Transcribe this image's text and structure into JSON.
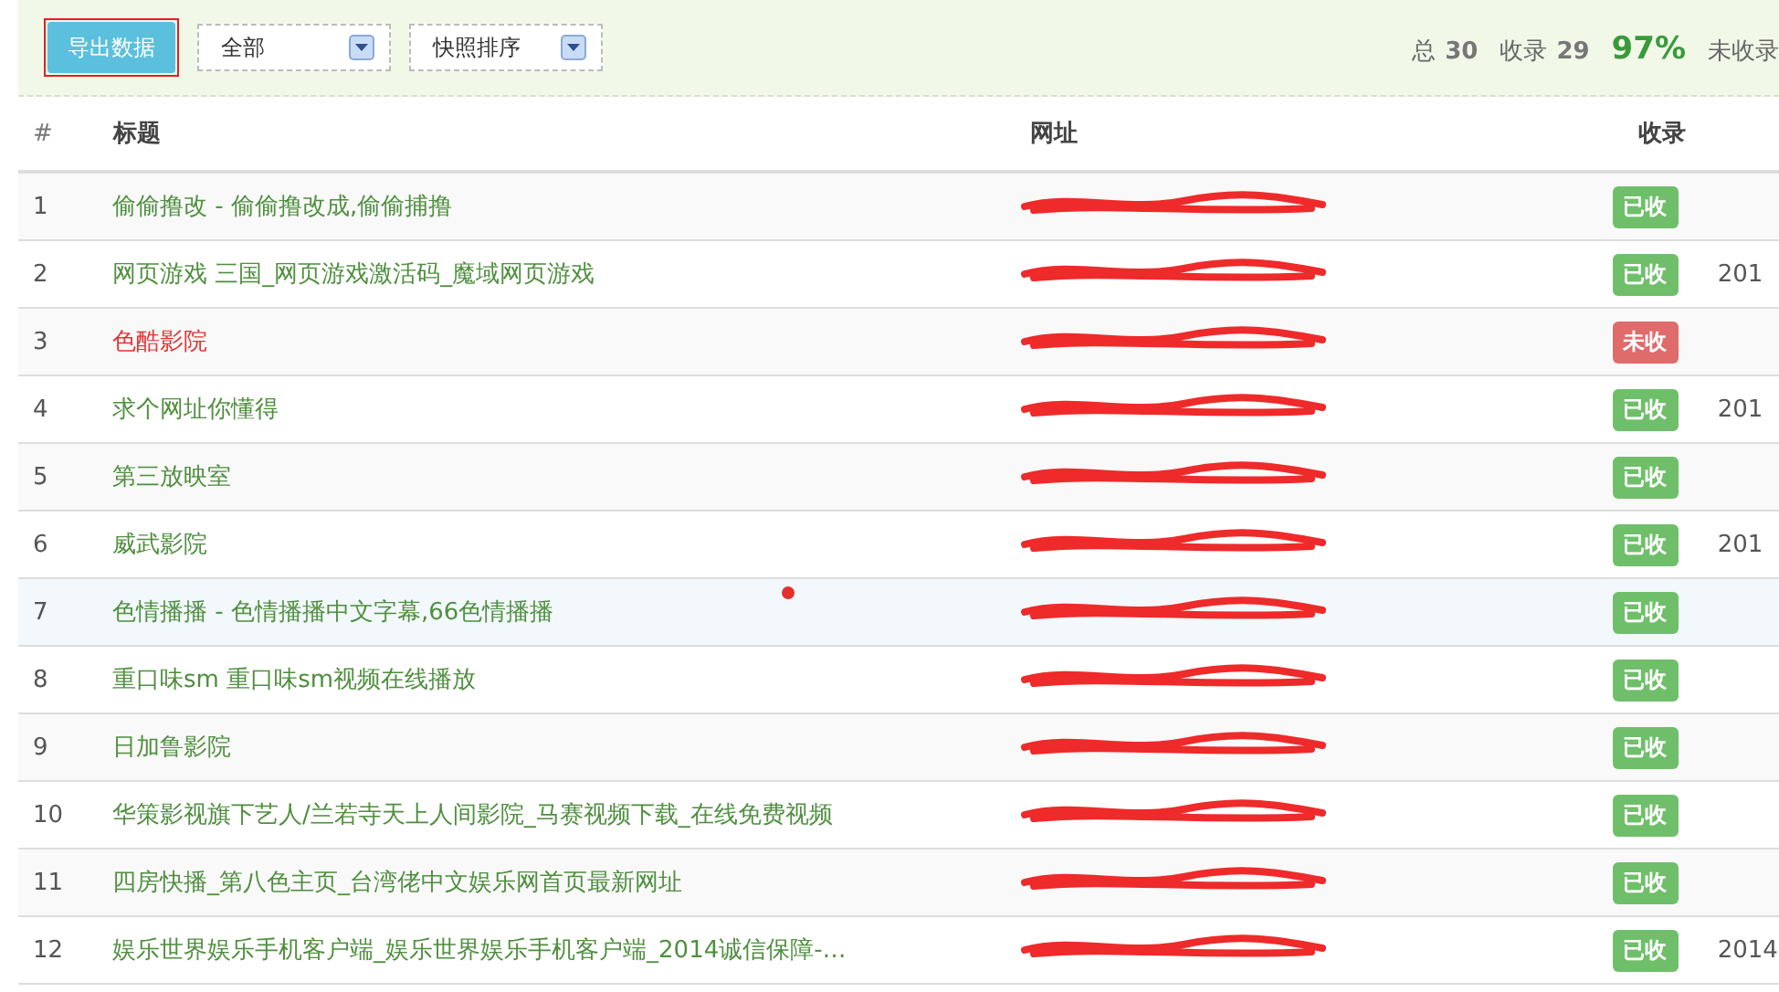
{
  "toolbar": {
    "export_button": {
      "label": "导出数据",
      "outlined": true
    },
    "dropdowns": [
      {
        "value": "全部"
      },
      {
        "value": "快照排序"
      }
    ],
    "stats": [
      {
        "label": "总",
        "value": "30"
      },
      {
        "label": "收录",
        "value": "29"
      },
      {
        "value": "97%",
        "kind": "percent"
      },
      {
        "label": "未收录"
      }
    ]
  },
  "table": {
    "columns": [
      "#",
      "标题",
      "网址",
      "收录"
    ],
    "rows": [
      {
        "index": "1",
        "title": "偷偷撸改 - 偷偷撸改成,偷偷捕撸",
        "url_redacted": true,
        "status": "已收",
        "kind": "indexed",
        "highlighted": false,
        "marked": false
      },
      {
        "index": "2",
        "title": "网页游戏 三国_网页游戏激活码_魔域网页游戏",
        "url_redacted": true,
        "status": "已收",
        "kind": "indexed",
        "date": "201",
        "highlighted": false,
        "marked": false
      },
      {
        "index": "3",
        "title": "色酷影院",
        "url_redacted": true,
        "status": "未收",
        "kind": "missing",
        "highlighted": false,
        "marked": false
      },
      {
        "index": "4",
        "title": "求个网址你懂得",
        "url_redacted": true,
        "status": "已收",
        "kind": "indexed",
        "date": "201",
        "highlighted": false,
        "marked": false
      },
      {
        "index": "5",
        "title": "第三放映室",
        "url_redacted": true,
        "status": "已收",
        "kind": "indexed",
        "highlighted": false,
        "marked": false
      },
      {
        "index": "6",
        "title": "威武影院",
        "url_redacted": true,
        "status": "已收",
        "kind": "indexed",
        "date": "201",
        "highlighted": false,
        "marked": false
      },
      {
        "index": "7",
        "title": "色情播播 - 色情播播中文字幕,66色情播播",
        "url_redacted": true,
        "status": "已收",
        "kind": "indexed",
        "highlighted": true,
        "marked": true
      },
      {
        "index": "8",
        "title": "重口味sm 重口味sm视频在线播放",
        "url_redacted": true,
        "status": "已收",
        "kind": "indexed",
        "highlighted": false,
        "marked": false
      },
      {
        "index": "9",
        "title": "日加鲁影院",
        "url_redacted": true,
        "status": "已收",
        "kind": "indexed",
        "highlighted": false,
        "marked": false
      },
      {
        "index": "10",
        "title": "华策影视旗下艺人/兰若寺天上人间影院_马赛视频下载_在线免费视频",
        "url_redacted": true,
        "status": "已收",
        "kind": "indexed",
        "highlighted": false,
        "marked": false
      },
      {
        "index": "11",
        "title": "四房快播_第八色主页_台湾佬中文娱乐网首页最新网址",
        "url_redacted": true,
        "status": "已收",
        "kind": "indexed",
        "highlighted": false,
        "marked": false
      },
      {
        "index": "12",
        "title": "娱乐世界娱乐手机客户端_娱乐世界娱乐手机客户端_2014诚信保障-…",
        "url_redacted": true,
        "status": "已收",
        "kind": "indexed",
        "date": "2014",
        "highlighted": false,
        "marked": false
      }
    ]
  }
}
